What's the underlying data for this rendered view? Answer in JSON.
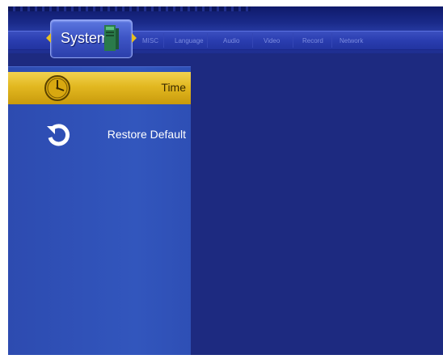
{
  "header": {
    "current_section": "System",
    "tabs": [
      "MISC",
      "Language",
      "Audio",
      "Video",
      "Record",
      "Network"
    ]
  },
  "menu": {
    "items": [
      {
        "label": "Time",
        "icon": "clock-icon",
        "selected": true
      },
      {
        "label": "Restore Default",
        "icon": "restore-icon",
        "selected": false
      }
    ]
  },
  "colors": {
    "background": "#1d2a80",
    "panel": "#3256bd",
    "highlight": "#e2b820",
    "tab_text": "#7c8ce0"
  }
}
